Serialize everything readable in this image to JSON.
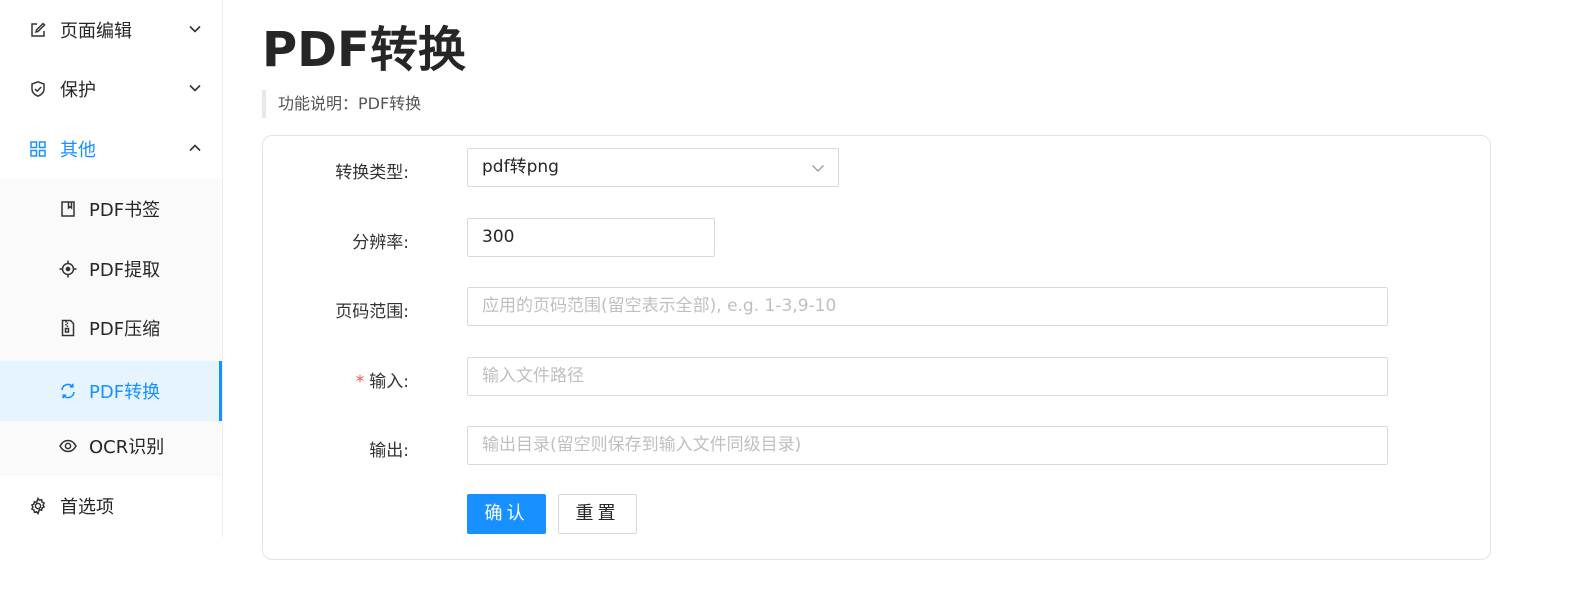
{
  "sidebar": {
    "items": [
      {
        "label": "页面编辑",
        "icon": "edit-icon",
        "state": "collapsed"
      },
      {
        "label": "保护",
        "icon": "shield-check-icon",
        "state": "collapsed"
      },
      {
        "label": "其他",
        "icon": "apps-grid-icon",
        "state": "expanded"
      },
      {
        "label": "首选项",
        "icon": "gear-icon"
      }
    ],
    "sub_items": [
      {
        "label": "PDF书签",
        "icon": "bookmark-icon"
      },
      {
        "label": "PDF提取",
        "icon": "aim-icon"
      },
      {
        "label": "PDF压缩",
        "icon": "file-zip-icon"
      },
      {
        "label": "PDF转换",
        "icon": "sync-icon",
        "active": true
      },
      {
        "label": "OCR识别",
        "icon": "eye-icon"
      }
    ]
  },
  "page": {
    "title": "PDF转换",
    "description": "功能说明：PDF转换"
  },
  "form": {
    "convert_type": {
      "label": "转换类型:",
      "value": "pdf转png"
    },
    "resolution": {
      "label": "分辨率:",
      "value": "300"
    },
    "page_range": {
      "label": "页码范围:",
      "placeholder": "应用的页码范围(留空表示全部), e.g. 1-3,9-10"
    },
    "input": {
      "label": "输入:",
      "required_mark": "*",
      "placeholder": "输入文件路径"
    },
    "output": {
      "label": "输出:",
      "placeholder": "输出目录(留空则保存到输入文件同级目录)"
    },
    "confirm_label": "确认",
    "reset_label": "重置"
  },
  "colors": {
    "accent": "#1890ff",
    "required": "#ff4d4f",
    "active_bg": "#e6f4ff"
  }
}
